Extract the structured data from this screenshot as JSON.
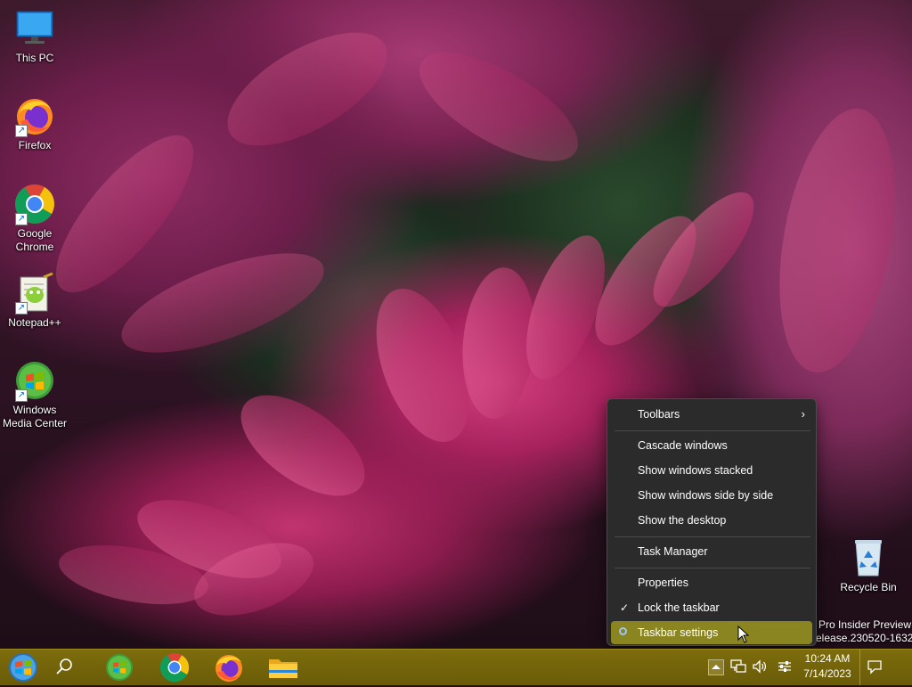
{
  "desktop": {
    "icons": [
      {
        "label": "This PC"
      },
      {
        "label": "Firefox"
      },
      {
        "label": "Google Chrome"
      },
      {
        "label": "Notepad++"
      },
      {
        "label": "Windows Media Center"
      },
      {
        "label": "Recycle Bin"
      }
    ],
    "watermark": {
      "line1": "Pro Insider Preview",
      "line2": "elease.230520-1632"
    }
  },
  "context_menu": {
    "items": [
      {
        "label": "Toolbars",
        "submenu": true
      },
      {
        "label": "Cascade windows"
      },
      {
        "label": "Show windows stacked"
      },
      {
        "label": "Show windows side by side"
      },
      {
        "label": "Show the desktop"
      },
      {
        "label": "Task Manager"
      },
      {
        "label": "Properties"
      },
      {
        "label": "Lock the taskbar",
        "checked": true
      },
      {
        "label": "Taskbar settings",
        "highlighted": true
      }
    ],
    "highlight_color": "#8a8520"
  },
  "taskbar": {
    "color": "#7a6a0c",
    "pinned": [
      {
        "name": "start-button"
      },
      {
        "name": "search-button"
      },
      {
        "name": "windows-media-center"
      },
      {
        "name": "google-chrome"
      },
      {
        "name": "firefox"
      },
      {
        "name": "file-explorer"
      }
    ],
    "clock": {
      "time": "10:24 AM",
      "date": "7/14/2023"
    }
  }
}
